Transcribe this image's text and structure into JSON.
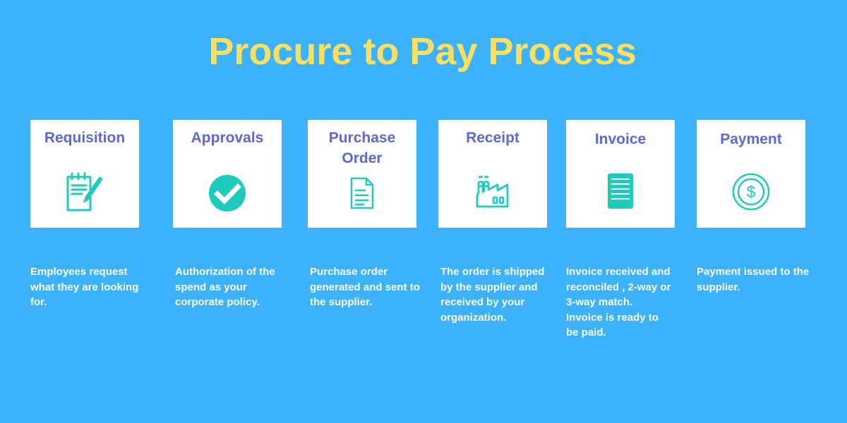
{
  "title": "Procure to Pay Process",
  "colors": {
    "background": "#3bb2fb",
    "title": "#fbdf5e",
    "card_title": "#5b68d9",
    "icon": "#1ecbbd",
    "description": "#ffffff"
  },
  "steps": [
    {
      "title": "Requisition",
      "icon": "notepad-pencil-icon",
      "description": "Employees request what they are looking for."
    },
    {
      "title": "Approvals",
      "icon": "check-circle-icon",
      "description": "Authorization of the spend as your corporate policy."
    },
    {
      "title": "Purchase Order",
      "icon": "document-icon",
      "description": "Purchase order generated and sent to the supplier."
    },
    {
      "title": "Receipt",
      "icon": "factory-icon",
      "description": "The order is shipped by the supplier and received by your organization."
    },
    {
      "title": "Invoice",
      "icon": "invoice-icon",
      "description": "Invoice received and reconciled , 2-way or 3-way match. Invoice is ready to be paid."
    },
    {
      "title": "Payment",
      "icon": "dollar-coin-icon",
      "description": "Payment issued to the supplier."
    }
  ]
}
